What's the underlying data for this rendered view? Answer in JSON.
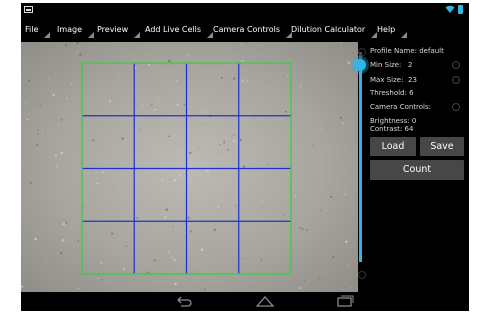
{
  "menu": [
    {
      "label": "File"
    },
    {
      "label": "Image"
    },
    {
      "label": "Preview"
    },
    {
      "label": "Add Live Cells"
    },
    {
      "label": "Camera Controls"
    },
    {
      "label": "Dilution Calculator"
    },
    {
      "label": "Help"
    }
  ],
  "panel": {
    "profile_name": "Profile Name: default",
    "min_size": "Min Size:",
    "min_size_value": "2",
    "max_size": "Max Size:",
    "max_size_value": "23",
    "threshold": "Threshold: 6",
    "camera_controls": "Camera Controls:",
    "brightness": "Brightness: 0",
    "contrast": "Contrast: 64",
    "load_label": "Load",
    "save_label": "Save",
    "count_label": "Count"
  },
  "slider": {
    "value_fraction": 0.94
  },
  "grid": {
    "rows": 4,
    "cols": 4,
    "outline_color": "#46c84a",
    "line_color": "#1c2fd8"
  },
  "status": {
    "accent_color": "#33b5e5"
  },
  "navbar": {
    "icons": [
      "back-icon",
      "home-icon",
      "recent-apps-icon"
    ]
  }
}
